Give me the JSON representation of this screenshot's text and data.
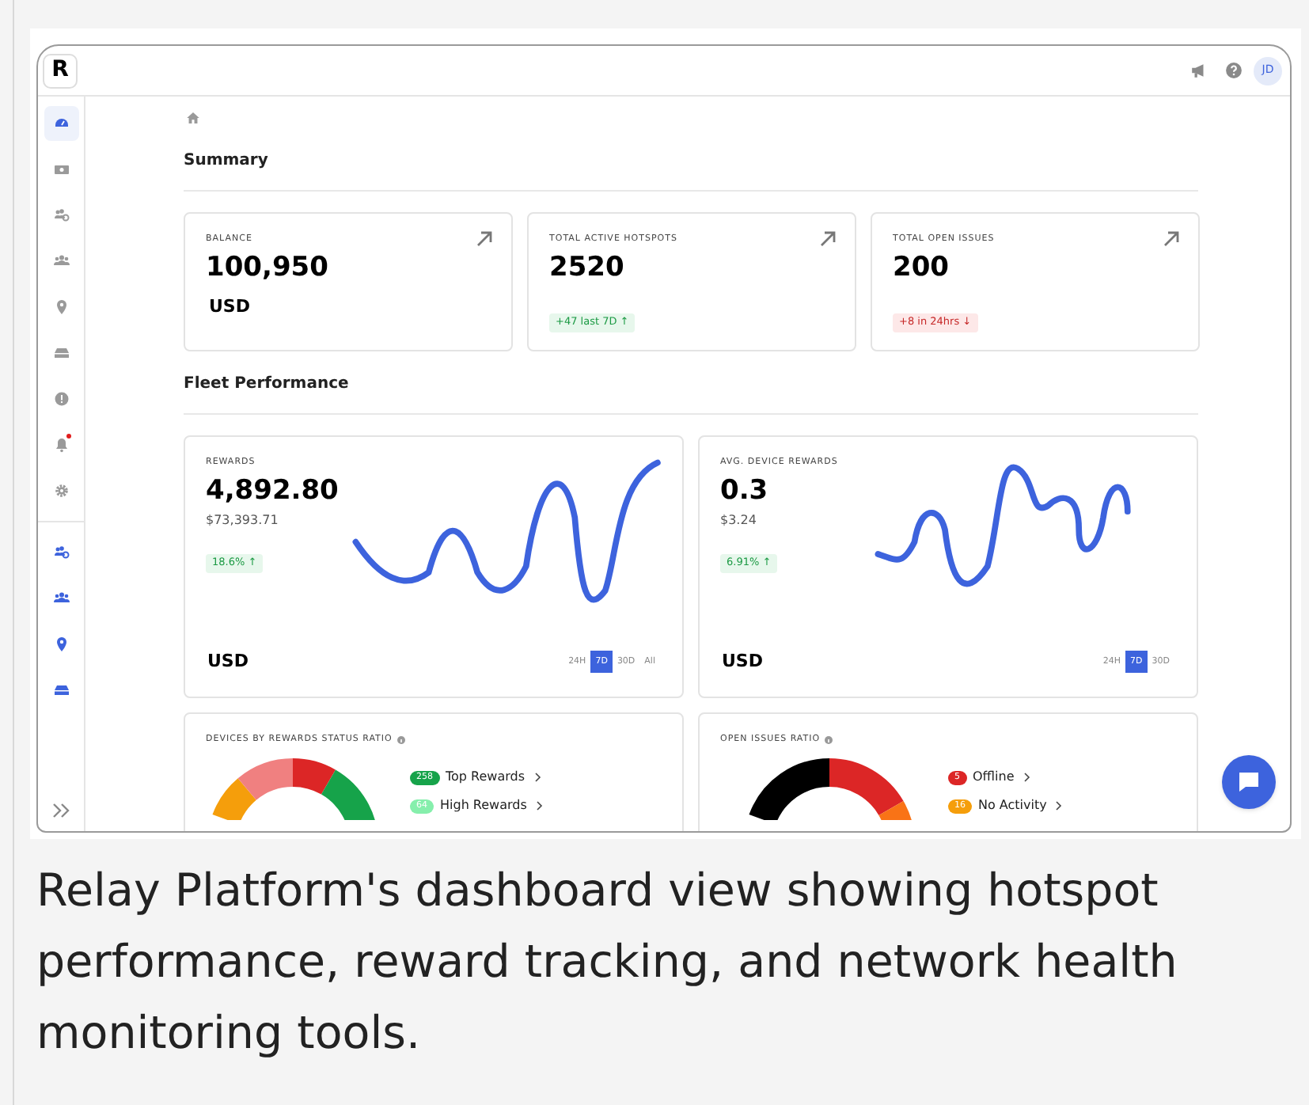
{
  "app": {
    "logo": "R",
    "header": {
      "avatar": "JD"
    },
    "sidebar": {
      "main_items": [
        {
          "selected": true,
          "notification": false
        },
        {
          "selected": false,
          "notification": false
        },
        {
          "selected": false,
          "notification": false
        },
        {
          "selected": false,
          "notification": false
        },
        {
          "selected": false,
          "notification": false
        },
        {
          "selected": false,
          "notification": false
        },
        {
          "selected": false,
          "notification": false
        },
        {
          "selected": false,
          "notification": true
        },
        {
          "selected": false,
          "notification": false
        }
      ]
    },
    "summary": {
      "title": "Summary",
      "cards": [
        {
          "label": "BALANCE",
          "value": "100,950",
          "unit": "USD"
        },
        {
          "label": "TOTAL ACTIVE HOTSPOTS",
          "value": "2520",
          "change": {
            "text": "+47 last 7D ↑",
            "positive": true
          }
        },
        {
          "label": "TOTAL OPEN ISSUES",
          "value": "200",
          "change": {
            "text": "+8 in 24hrs ↓",
            "positive": false
          }
        }
      ]
    },
    "fleet": {
      "title": "Fleet Performance",
      "cards": [
        {
          "label": "REWARDS",
          "value": "4,892.80",
          "subvalue": "$73,393.71",
          "change": {
            "text": "18.6% ↑",
            "positive": true
          },
          "unit": "USD",
          "ranges": [
            {
              "label": "24H",
              "selected": false
            },
            {
              "label": "7D",
              "selected": true
            },
            {
              "label": "30D",
              "selected": false
            },
            {
              "label": "All",
              "selected": false
            }
          ]
        },
        {
          "label": "AVG. DEVICE REWARDS",
          "value": "0.3",
          "subvalue": "$3.24",
          "change": {
            "text": "6.91% ↑",
            "positive": true
          },
          "unit": "USD",
          "ranges": [
            {
              "label": "24H",
              "selected": false
            },
            {
              "label": "7D",
              "selected": true
            },
            {
              "label": "30D",
              "selected": false
            }
          ]
        }
      ],
      "ratio_cards": [
        {
          "title": "DEVICES BY REWARDS STATUS RATIO",
          "legend": [
            {
              "count": "258",
              "label": "Top Rewards",
              "color": "#16a34a"
            },
            {
              "count": "64",
              "label": "High Rewards",
              "color": "#86efac"
            }
          ]
        },
        {
          "title": "OPEN ISSUES RATIO",
          "legend": [
            {
              "count": "5",
              "label": "Offline",
              "color": "#dc2626"
            },
            {
              "count": "16",
              "label": "No Activity",
              "color": "#f59e0b"
            }
          ]
        }
      ]
    }
  },
  "caption": "Relay Platform's dashboard view showing hotspot performance, reward tracking, and network health monitoring tools."
}
